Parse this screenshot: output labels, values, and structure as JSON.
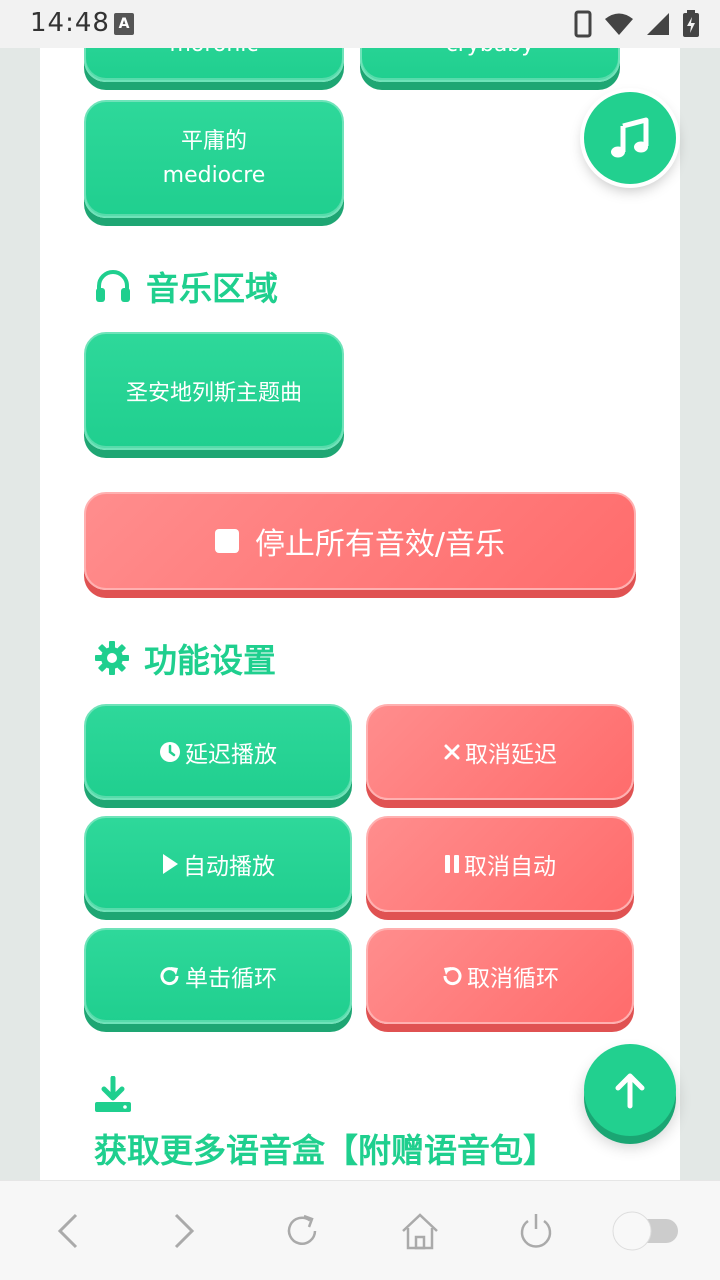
{
  "status_bar": {
    "time": "14:48",
    "notification_letter": "A"
  },
  "words": [
    {
      "chinese": "",
      "english": "moronic"
    },
    {
      "chinese": "",
      "english": "crybaby"
    },
    {
      "chinese": "平庸的",
      "english": "mediocre"
    }
  ],
  "music_section": {
    "title": "音乐区域",
    "items": [
      "圣安地列斯主题曲"
    ],
    "stop_label": "停止所有音效/音乐"
  },
  "settings_section": {
    "title": "功能设置",
    "buttons": [
      {
        "label": "延迟播放",
        "icon": "clock-icon",
        "color": "green"
      },
      {
        "label": "取消延迟",
        "icon": "x-icon",
        "color": "red"
      },
      {
        "label": "自动播放",
        "icon": "play-icon",
        "color": "green"
      },
      {
        "label": "取消自动",
        "icon": "pause-icon",
        "color": "red"
      },
      {
        "label": "单击循环",
        "icon": "redo-icon",
        "color": "green"
      },
      {
        "label": "取消循环",
        "icon": "undo-icon",
        "color": "red"
      }
    ]
  },
  "more_section": {
    "title": "获取更多语音盒【附赠语音包】",
    "icon": "download-icon"
  },
  "colors": {
    "green": "#22d08f",
    "red": "#ff7474",
    "title_green": "#1fcf8e"
  },
  "toolbar": {
    "items": [
      "back-icon",
      "forward-icon",
      "refresh-icon",
      "home-icon",
      "power-icon",
      "toggle-switch"
    ]
  }
}
